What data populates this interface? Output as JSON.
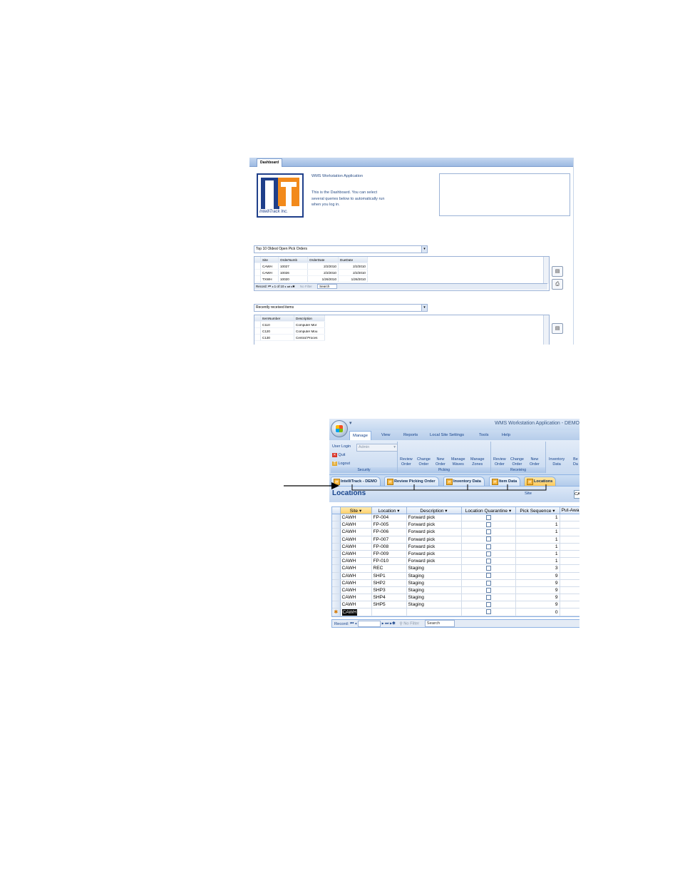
{
  "dashboard": {
    "tab_label": "Dashboard",
    "logo": {
      "text_it": "IT",
      "text_brand": "IntelliTrack Inc."
    },
    "app_name": "WMS Workstation Application",
    "description_1": "This is the Dashboard. You can select",
    "description_2": "several queries below to automatically run",
    "description_3": "when you log in.",
    "query1": {
      "combo_value": "Top 10 Oldest Open Pick Orders",
      "columns": [
        "Site",
        "OrderNumb",
        "OrderDate",
        "DueDate"
      ],
      "rows": [
        [
          "CAWH",
          "10027",
          "2/2/2010",
          "2/2/2010"
        ],
        [
          "CAWH",
          "10026",
          "2/2/2010",
          "2/2/2010"
        ],
        [
          "TXWH",
          "10020",
          "1/26/2010",
          "1/26/2010"
        ]
      ],
      "nav": {
        "record_label": "Record:",
        "position": "1 of 10",
        "filter": "No Filter",
        "search": "Search"
      }
    },
    "query2": {
      "combo_value": "Recently received items",
      "columns": [
        "ItemNumber",
        "Description"
      ],
      "rows": [
        [
          "C110",
          "Computer Mor"
        ],
        [
          "C120",
          "Computer Mou"
        ],
        [
          "C130",
          "Central Proces"
        ]
      ]
    }
  },
  "app": {
    "title": "WMS Workstation Application - DEMO",
    "quick_access": "▾",
    "menu": [
      "Manage",
      "View",
      "Reports",
      "Local Site Settings",
      "Tools",
      "Help"
    ],
    "active_menu": "Manage",
    "ribbon": {
      "security": {
        "label": "Security",
        "user_login_label": "User Login",
        "user_login_value": "Admin",
        "quit": "Quit",
        "logout": "Logout"
      },
      "picking": {
        "label": "Picking",
        "buttons": [
          {
            "line1": "Review",
            "line2": "Order"
          },
          {
            "line1": "Change",
            "line2": "Order"
          },
          {
            "line1": "New",
            "line2": "Order"
          },
          {
            "line1": "Manage",
            "line2": "Waves"
          },
          {
            "line1": "Manage",
            "line2": "Zones"
          }
        ]
      },
      "receiving": {
        "label": "Receiving",
        "buttons": [
          {
            "line1": "Review",
            "line2": "Order"
          },
          {
            "line1": "Change",
            "line2": "Order"
          },
          {
            "line1": "New",
            "line2": "Order"
          }
        ]
      },
      "inventory": {
        "buttons": [
          {
            "line1": "Inventory",
            "line2": "Data"
          },
          {
            "line1": "Be",
            "line2": "Da"
          }
        ]
      }
    },
    "doc_tabs": [
      "IntelliTrack - DEMO",
      "Review Picking Order",
      "Inventory Data",
      "Item Data",
      "Locations"
    ],
    "active_tab": "Locations",
    "form": {
      "title": "Locations",
      "site_label": "Site",
      "site_value": "CA"
    },
    "grid": {
      "columns": [
        "Site",
        "Location",
        "Description",
        "Location Quarantine",
        "Pick Sequence",
        "Put-Awa"
      ],
      "rows": [
        [
          "CAWH",
          "FP-004",
          "Forward pick",
          "1"
        ],
        [
          "CAWH",
          "FP-005",
          "Forward pick",
          "1"
        ],
        [
          "CAWH",
          "FP-006",
          "Forward pick",
          "1"
        ],
        [
          "CAWH",
          "FP-007",
          "Forward pick",
          "1"
        ],
        [
          "CAWH",
          "FP-008",
          "Forward pick",
          "1"
        ],
        [
          "CAWH",
          "FP-009",
          "Forward pick",
          "1"
        ],
        [
          "CAWH",
          "FP-010",
          "Forward pick",
          "1"
        ],
        [
          "CAWH",
          "REC",
          "Staging",
          "3"
        ],
        [
          "CAWH",
          "SHP1",
          "Staging",
          "9"
        ],
        [
          "CAWH",
          "SHP2",
          "Staging",
          "9"
        ],
        [
          "CAWH",
          "SHP3",
          "Staging",
          "9"
        ],
        [
          "CAWH",
          "SHP4",
          "Staging",
          "9"
        ],
        [
          "CAWH",
          "SHP5",
          "Staging",
          "9"
        ]
      ],
      "new_row": {
        "marker": "✱",
        "site": "CAWH",
        "pick_sequence": "0"
      }
    },
    "navbar": {
      "record_label": "Record:",
      "filter": "No Filter",
      "search": "Search"
    }
  }
}
